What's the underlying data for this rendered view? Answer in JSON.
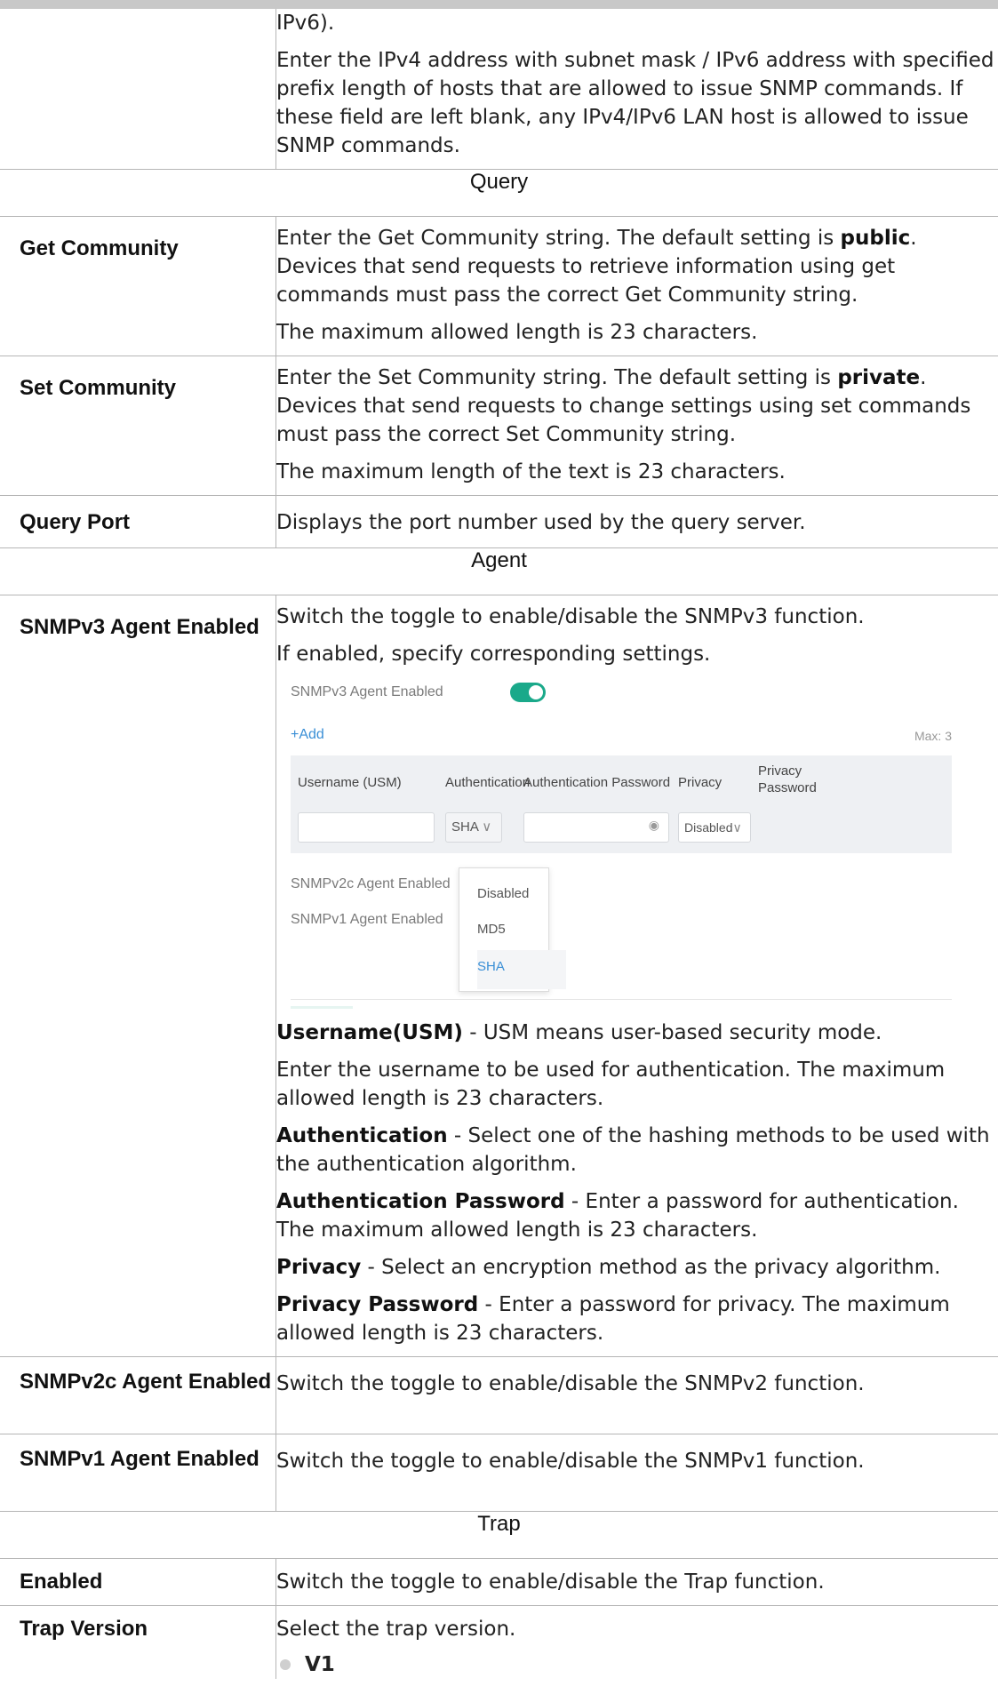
{
  "top_row": {
    "lines": [
      "IPv6).",
      "Enter the IPv4 address with subnet mask / IPv6 address with specified prefix length of hosts that are allowed to issue SNMP commands. If these field are left blank, any IPv4/IPv6 LAN host is allowed to issue SNMP commands."
    ]
  },
  "sections": {
    "query": "Query",
    "agent": "Agent",
    "trap": "Trap"
  },
  "get_community": {
    "label": "Get Community",
    "p1_a": "Enter the Get Community string. The default setting is ",
    "p1_b": "public",
    "p1_c": ". Devices that send requests to retrieve information using get commands must pass the correct Get Community string.",
    "p2": "The maximum allowed length is 23 characters."
  },
  "set_community": {
    "label": "Set Community",
    "p1_a": "Enter the Set Community string. The default setting is ",
    "p1_b": "private",
    "p1_c": ". Devices that send requests to change settings using set commands must pass the correct Set Community string.",
    "p2": "The maximum length of the text is 23 characters."
  },
  "query_port": {
    "label": "Query Port",
    "desc": "Displays the port number used by the query server."
  },
  "snmpv3": {
    "label": "SNMPv3 Agent Enabled",
    "p1": "Switch the toggle to enable/disable the SNMPv3 function.",
    "p2": "If enabled, specify corresponding settings.",
    "screenshot": {
      "v3_label": "SNMPv3 Agent Enabled",
      "v3_toggle_on": true,
      "add": "+Add",
      "max": "Max: 3",
      "col_user": "Username (USM)",
      "col_auth": "Authentication",
      "col_authpw": "Authentication Password",
      "col_priv": "Privacy",
      "col_privpw": "Privacy Password",
      "auth_value": "SHA",
      "priv_value": "Disabled",
      "v2c_label": "SNMPv2c Agent Enabled",
      "v1_label": "SNMPv1 Agent Enabled",
      "options": [
        "Disabled",
        "MD5",
        "SHA"
      ],
      "eye_icon": "eye-icon",
      "accent": "#1aa98a",
      "link": "#3a8fd6"
    },
    "d1_term": "Username(USM)",
    "d1_text": " - USM means user-based security mode.",
    "d2": "Enter the username to be used for authentication. The maximum allowed length is 23 characters.",
    "d3_term": "Authentication",
    "d3_text": " - Select one of the hashing methods to be used with the authentication algorithm.",
    "d4_term": "Authentication Password",
    "d4_text": " - Enter a password for authentication. The maximum allowed length is 23 characters.",
    "d5_term": "Privacy",
    "d5_text": " - Select an encryption method as the privacy algorithm.",
    "d6_term": "Privacy Password",
    "d6_text": " - Enter a password for privacy. The maximum allowed length is 23 characters."
  },
  "snmpv2c": {
    "label": "SNMPv2c Agent Enabled",
    "desc": "Switch the toggle to enable/disable the SNMPv2 function."
  },
  "snmpv1": {
    "label": "SNMPv1 Agent Enabled",
    "desc": "Switch the toggle to enable/disable the SNMPv1 function."
  },
  "trap_enabled": {
    "label": "Enabled",
    "desc": "Switch the toggle to enable/disable the Trap function."
  },
  "trap_version": {
    "label": "Trap Version",
    "desc": "Select the trap version.",
    "option1": "V1"
  }
}
